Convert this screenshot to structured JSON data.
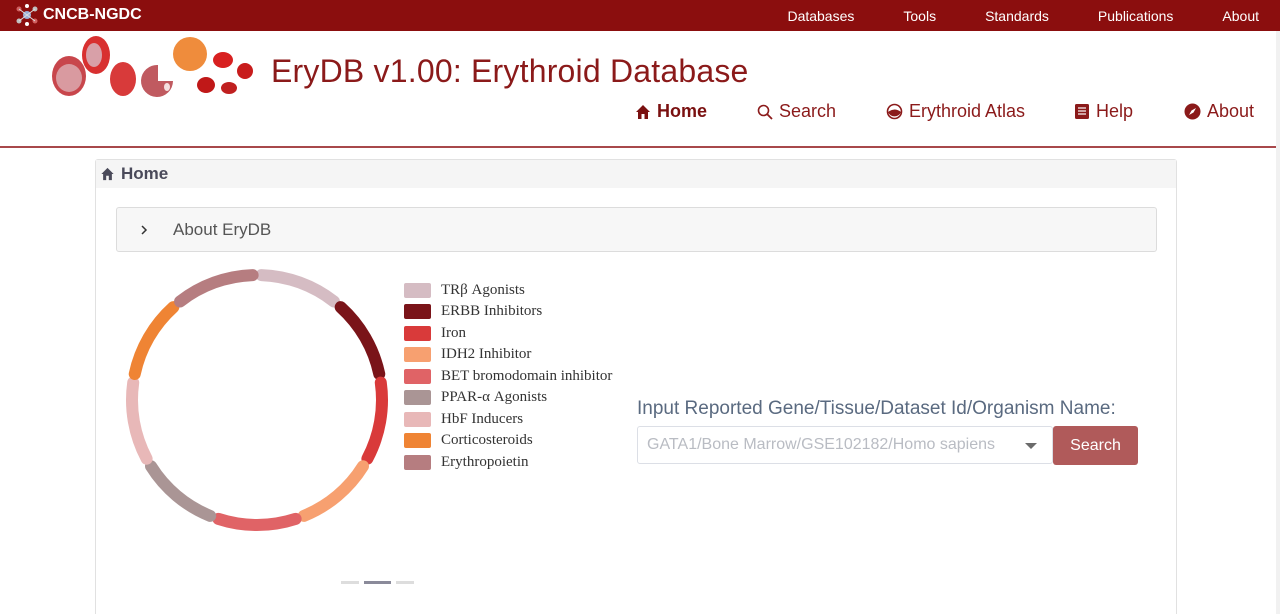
{
  "topbar": {
    "brand": "CNCB-NGDC",
    "nav": [
      "Databases",
      "Tools",
      "Standards",
      "Publications",
      "About"
    ]
  },
  "header": {
    "title": "EryDB v1.00: Erythroid Database",
    "nav": [
      {
        "label": "Home",
        "icon": "home-icon",
        "active": true
      },
      {
        "label": "Search",
        "icon": "search-icon",
        "active": false
      },
      {
        "label": "Erythroid Atlas",
        "icon": "atlas-icon",
        "active": false
      },
      {
        "label": "Help",
        "icon": "book-icon",
        "active": false
      },
      {
        "label": "About",
        "icon": "compass-icon",
        "active": false
      }
    ]
  },
  "breadcrumb": {
    "title": "Home"
  },
  "accordion": {
    "label": "About EryDB"
  },
  "legend": [
    {
      "label": "TRβ Agonists",
      "color": "#d5bcc3"
    },
    {
      "label": "ERBB Inhibitors",
      "color": "#7a1419"
    },
    {
      "label": " Iron",
      "color": "#d93a3a"
    },
    {
      "label": "IDH2 Inhibitor",
      "color": "#f7a070"
    },
    {
      "label": "BET bromodomain inhibitor",
      "color": "#e06366"
    },
    {
      "label": "PPAR-α Agonists",
      "color": "#aa9595"
    },
    {
      "label": "HbF Inducers",
      "color": "#e8b8b8"
    },
    {
      "label": "Corticosteroids",
      "color": "#ef8434"
    },
    {
      "label": "Erythropoietin",
      "color": "#b67d80"
    }
  ],
  "search": {
    "label": "Input Reported Gene/Tissue/Dataset Id/Organism Name:",
    "placeholder": "GATA1/Bone Marrow/GSE102182/Homo sapiens",
    "button": "Search"
  },
  "carousel": {
    "pages": 3,
    "active": 2
  },
  "colors": {
    "brand": "#8b0e0e",
    "title": "#8b1a1a",
    "button": "#b05a5a"
  }
}
